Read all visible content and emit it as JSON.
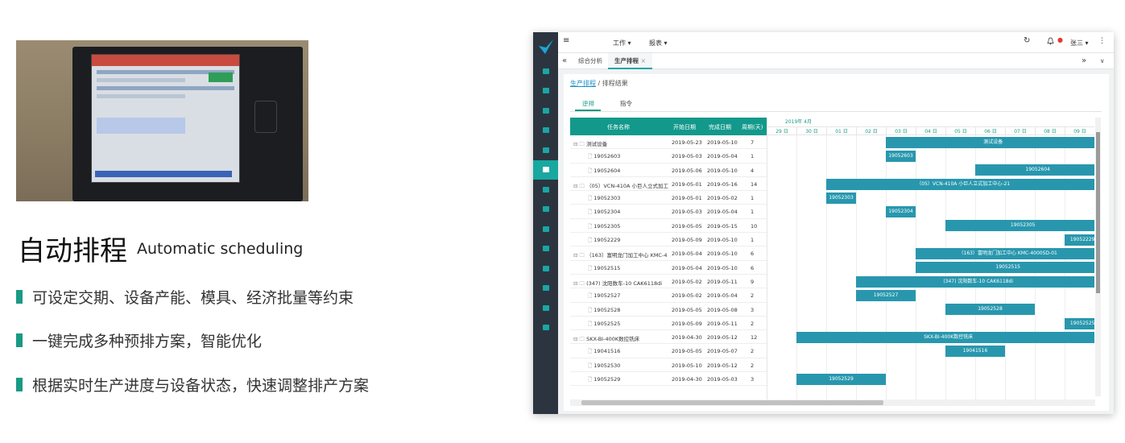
{
  "promo": {
    "title": "自动排程",
    "subtitle": "Automatic scheduling",
    "bullets": [
      "可设定交期、设备产能、模具、经济批量等约束",
      "一键完成多种预排方案，智能优化",
      "根据实时生产进度与设备状态，快速调整排产方案"
    ],
    "accent_color": "#1a9a84"
  },
  "app": {
    "topbar": {
      "menu_icon": "hamburger-icon",
      "nav": [
        "工作 ▾",
        "报表 ▾"
      ],
      "user": "张三 ▾",
      "icons": [
        "refresh-icon",
        "bell-icon",
        "more-vertical-icon"
      ]
    },
    "tabs": {
      "collapse": "«",
      "items": [
        "综合分析",
        "生产排程"
      ],
      "close": "×",
      "right": "»",
      "dropdown": "∨"
    },
    "breadcrumb": {
      "link": "生产排程",
      "sep": " / ",
      "current": "排程结果"
    },
    "subtabs": [
      "逆排",
      "指令"
    ],
    "grid": {
      "headers": [
        "任务名称",
        "开始日期",
        "完成日期",
        "周期(天)"
      ],
      "rows": [
        {
          "name": "测试设备",
          "start": "2019-05-23",
          "end": "2019-05-10",
          "days": "7",
          "group": true
        },
        {
          "name": "19052603",
          "start": "2019-05-03",
          "end": "2019-05-04",
          "days": "1",
          "group": false
        },
        {
          "name": "19052604",
          "start": "2019-05-06",
          "end": "2019-05-10",
          "days": "4",
          "group": false
        },
        {
          "name": "（05）VCN-410A 小巨人立式加工",
          "start": "2019-05-01",
          "end": "2019-05-16",
          "days": "14",
          "group": true
        },
        {
          "name": "19052303",
          "start": "2019-05-01",
          "end": "2019-05-02",
          "days": "1",
          "group": false
        },
        {
          "name": "19052304",
          "start": "2019-05-03",
          "end": "2019-05-04",
          "days": "1",
          "group": false
        },
        {
          "name": "19052305",
          "start": "2019-05-05",
          "end": "2019-05-15",
          "days": "10",
          "group": false
        },
        {
          "name": "19052229",
          "start": "2019-05-09",
          "end": "2019-05-10",
          "days": "1",
          "group": false
        },
        {
          "name": "（163）富明龙门加工中心 KMC-4",
          "start": "2019-05-04",
          "end": "2019-05-10",
          "days": "6",
          "group": true
        },
        {
          "name": "19052515",
          "start": "2019-05-04",
          "end": "2019-05-10",
          "days": "6",
          "group": false
        },
        {
          "name": "(347) 沈阳数车-10 CAK6118di",
          "start": "2019-05-02",
          "end": "2019-05-11",
          "days": "9",
          "group": true
        },
        {
          "name": "19052527",
          "start": "2019-05-02",
          "end": "2019-05-04",
          "days": "2",
          "group": false
        },
        {
          "name": "19052528",
          "start": "2019-05-05",
          "end": "2019-05-08",
          "days": "3",
          "group": false
        },
        {
          "name": "19052525",
          "start": "2019-05-09",
          "end": "2019-05-11",
          "days": "2",
          "group": false
        },
        {
          "name": "SKX-BI-400K数控铣床",
          "start": "2019-04-30",
          "end": "2019-05-12",
          "days": "12",
          "group": true
        },
        {
          "name": "19041516",
          "start": "2019-05-05",
          "end": "2019-05-07",
          "days": "2",
          "group": false
        },
        {
          "name": "19052530",
          "start": "2019-05-10",
          "end": "2019-05-12",
          "days": "2",
          "group": false
        },
        {
          "name": "19052529",
          "start": "2019-04-30",
          "end": "2019-05-03",
          "days": "3",
          "group": false
        }
      ]
    },
    "gantt": {
      "month": "2019年 4月",
      "days": [
        "29 日",
        "30 日",
        "01 日",
        "02 日",
        "03 日",
        "04 日",
        "05 日",
        "06 日",
        "07 日",
        "08 日",
        "09 日"
      ],
      "bars": [
        {
          "row": 0,
          "start": 4,
          "span": 7.2,
          "label": "测试设备"
        },
        {
          "row": 1,
          "start": 4,
          "span": 1,
          "label": "19052603"
        },
        {
          "row": 2,
          "start": 7,
          "span": 4.2,
          "label": "19052604"
        },
        {
          "row": 3,
          "start": 2,
          "span": 9.2,
          "label": "（05）VCN-410A 小巨人立式加工中心-21"
        },
        {
          "row": 4,
          "start": 2,
          "span": 1,
          "label": "19052303"
        },
        {
          "row": 5,
          "start": 4,
          "span": 1,
          "label": "19052304"
        },
        {
          "row": 6,
          "start": 6,
          "span": 5.2,
          "label": "19052305"
        },
        {
          "row": 7,
          "start": 10,
          "span": 1.2,
          "label": "19052229"
        },
        {
          "row": 8,
          "start": 5,
          "span": 6.2,
          "label": "（163）富明龙门加工中心 KMC-4000SD-01"
        },
        {
          "row": 9,
          "start": 5,
          "span": 6.2,
          "label": "19052515"
        },
        {
          "row": 10,
          "start": 3,
          "span": 8.2,
          "label": "(347) 沈阳数车-10 CAK6118di"
        },
        {
          "row": 11,
          "start": 3,
          "span": 2,
          "label": "19052527"
        },
        {
          "row": 12,
          "start": 6,
          "span": 3,
          "label": "19052528"
        },
        {
          "row": 13,
          "start": 10,
          "span": 1.2,
          "label": "19052525"
        },
        {
          "row": 14,
          "start": 1,
          "span": 10.2,
          "label": "SKX-BI-400K数控铣床"
        },
        {
          "row": 15,
          "start": 6,
          "span": 2,
          "label": "19041516"
        },
        {
          "row": 17,
          "start": 1,
          "span": 3,
          "label": "19052529"
        }
      ]
    }
  }
}
